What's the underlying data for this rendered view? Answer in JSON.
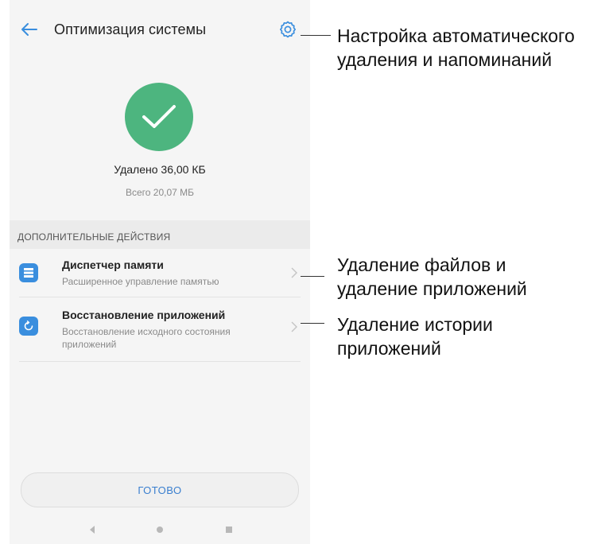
{
  "screen": {
    "title": "Оптимизация системы",
    "status": {
      "deleted_text": "Удалено 36,00 КБ",
      "total_text": "Всего 20,07 МБ"
    },
    "section_header": "ДОПОЛНИТЕЛЬНЫЕ ДЕЙСТВИЯ",
    "items": [
      {
        "title": "Диспетчер памяти",
        "subtitle": "Расширенное управление памятью",
        "icon": "storage-list-icon"
      },
      {
        "title": "Восстановление приложений",
        "subtitle": "Восстановление исходного состояния приложений",
        "icon": "app-restore-icon"
      }
    ],
    "done_button": "ГОТОВО"
  },
  "callouts": [
    "Настройка автоматического\nудаления и напоминаний",
    "Удаление файлов и\nудаление приложений",
    "Удаление истории\nприложений"
  ],
  "colors": {
    "accent": "#3a8ede",
    "success": "#4db57f",
    "background": "#f5f5f5"
  }
}
